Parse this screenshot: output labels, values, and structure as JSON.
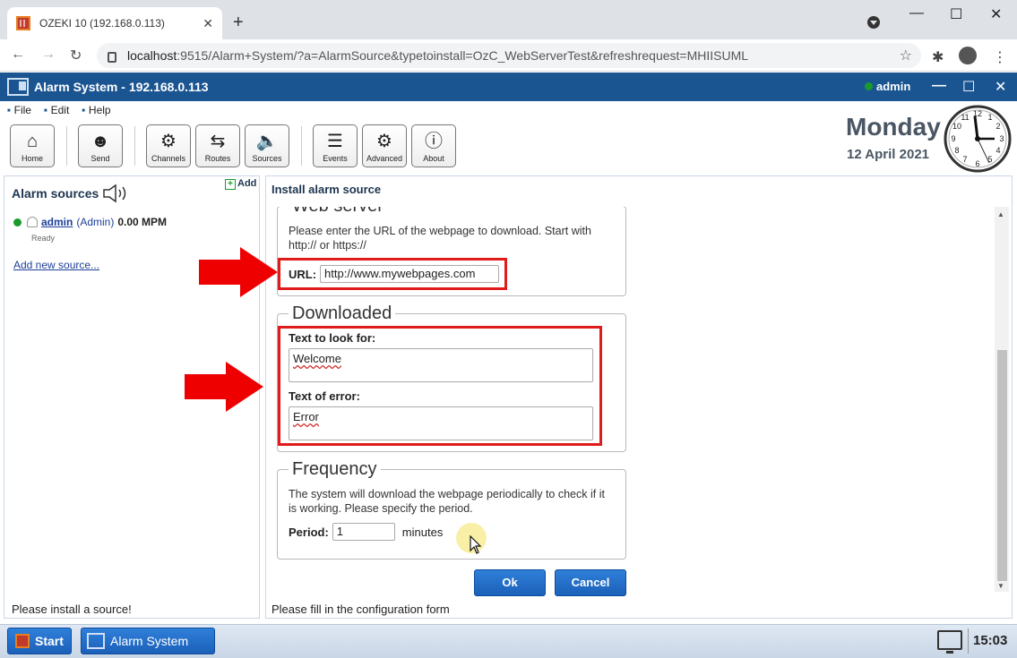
{
  "browser": {
    "tab_title": "OZEKI 10 (192.168.0.113)",
    "tab_close": "✕",
    "new_tab": "+",
    "url_host": "localhost",
    "url_rest": ":9515/Alarm+System/?a=AlarmSource&typetoinstall=OzC_WebServerTest&refreshrequest=MHIISUML",
    "back": "←",
    "forward": "→",
    "reload": "↻",
    "star": "☆"
  },
  "app": {
    "title": "Alarm System - 192.168.0.113",
    "user": "admin",
    "menu": [
      "File",
      "Edit",
      "Help"
    ],
    "toolbar": [
      {
        "label": "Home",
        "icon": "⌂"
      },
      {
        "label": "Send",
        "icon": "☻"
      },
      {
        "label": "Channels",
        "icon": "⚙"
      },
      {
        "label": "Routes",
        "icon": "⇆"
      },
      {
        "label": "Sources",
        "icon": "🔈"
      },
      {
        "label": "Events",
        "icon": "☰"
      },
      {
        "label": "Advanced",
        "icon": "⚙"
      },
      {
        "label": "About",
        "icon": "ⓘ"
      }
    ],
    "day_name": "Monday",
    "date": "12 April 2021"
  },
  "left_panel": {
    "title": "Alarm sources",
    "add_label": "Add",
    "source": {
      "name": "admin",
      "role": "(Admin)",
      "rate": "0.00 MPM",
      "status": "Ready"
    },
    "add_new": "Add new source...",
    "footer": "Please install a source!"
  },
  "right_panel": {
    "title": "Install alarm source",
    "footer": "Please fill in the configuration form",
    "web_server": {
      "legend": "Web server",
      "description": "Please enter the URL of the webpage to download. Start with http:// or https://",
      "url_label": "URL:",
      "url_value": "http://www.mywebpages.com"
    },
    "downloaded": {
      "legend": "Downloaded",
      "look_for_label": "Text to look for:",
      "look_for_value": "Welcome",
      "error_label": "Text of error:",
      "error_value": "Error"
    },
    "frequency": {
      "legend": "Frequency",
      "description": "The system will download the webpage periodically to check if it is working. Please specify the period.",
      "period_label": "Period:",
      "period_value": "1",
      "unit": "minutes"
    },
    "ok_label": "Ok",
    "cancel_label": "Cancel"
  },
  "taskbar": {
    "start": "Start",
    "app": "Alarm System",
    "time": "15:03"
  },
  "colors": {
    "titlebar": "#1a5591",
    "highlight": "#e01b1b",
    "button": "#1b60b8"
  }
}
